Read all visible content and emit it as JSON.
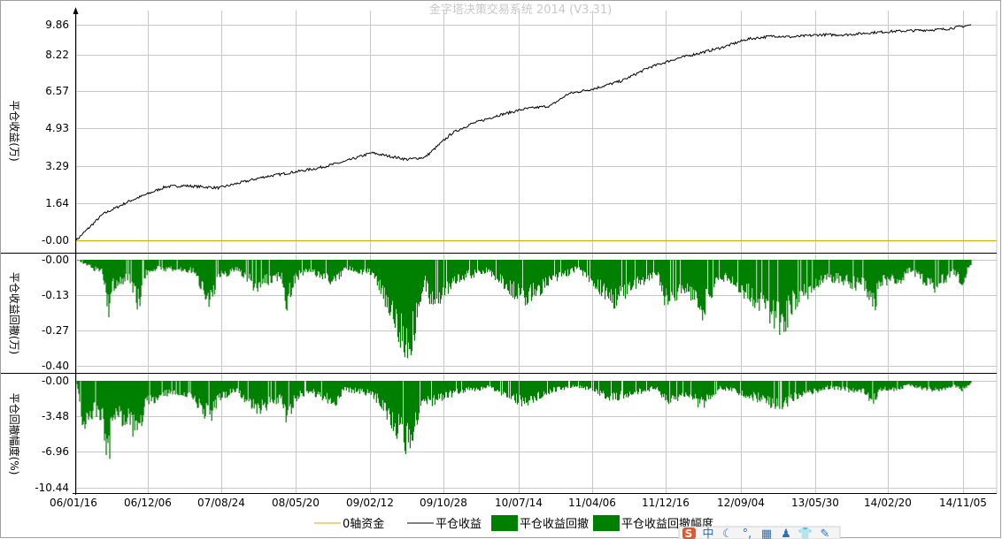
{
  "title": "金字塔决策交易系统 2014 (V3.31)",
  "colors": {
    "equity": "#000000",
    "zero_line": "#d4aa00",
    "drawdown": "#008000",
    "grid": "#c8c8c8",
    "toolbar_s": "#e8532a",
    "toolbar_blue": "#2e6fb8"
  },
  "x_tick_labels": [
    "06/01/16",
    "06/12/06",
    "07/08/24",
    "08/05/20",
    "09/02/12",
    "09/10/28",
    "10/07/14",
    "11/04/06",
    "11/12/16",
    "12/09/04",
    "13/05/30",
    "14/02/20",
    "14/11/05"
  ],
  "legend": [
    {
      "label": "0轴资金",
      "kind": "line",
      "color": "#d4aa00"
    },
    {
      "label": "平仓收益",
      "kind": "line",
      "color": "#000000"
    },
    {
      "label": "平仓收益回撤",
      "kind": "box",
      "color": "#008000"
    },
    {
      "label": "平仓收益回撤幅度",
      "kind": "box",
      "color": "#008000"
    }
  ],
  "toolbar_icons": [
    "sogou-s-icon",
    "chinese-input-icon",
    "moon-icon",
    "punctuation-icon",
    "keyboard-icon",
    "user-icon",
    "shirt-icon",
    "wrench-icon"
  ],
  "chart_data": [
    {
      "type": "line",
      "ylabel": "平仓收益(万)",
      "y_ticks": [
        "9.86",
        "8.22",
        "6.57",
        "4.93",
        "3.29",
        "1.64",
        "-0.00"
      ],
      "ylim": [
        -0.1,
        10.1
      ],
      "series": [
        {
          "name": "0轴资金",
          "values": [
            0.0,
            0.0
          ]
        },
        {
          "name": "平仓收益",
          "x": [
            0,
            0.01,
            0.03,
            0.06,
            0.1,
            0.12,
            0.16,
            0.21,
            0.27,
            0.3,
            0.33,
            0.37,
            0.39,
            0.42,
            0.44,
            0.47,
            0.5,
            0.53,
            0.55,
            0.58,
            0.61,
            0.64,
            0.67,
            0.69,
            0.72,
            0.75,
            0.78,
            0.8,
            0.83,
            0.86,
            0.89,
            0.91,
            0.94,
            0.97,
            1.0
          ],
          "values": [
            0.0,
            0.4,
            1.2,
            1.8,
            2.45,
            2.5,
            2.4,
            2.9,
            3.3,
            3.6,
            4.0,
            3.7,
            3.8,
            4.9,
            5.3,
            5.7,
            6.0,
            6.15,
            6.7,
            6.95,
            7.3,
            7.9,
            8.3,
            8.5,
            8.8,
            9.2,
            9.35,
            9.3,
            9.4,
            9.4,
            9.5,
            9.55,
            9.6,
            9.65,
            9.85
          ]
        }
      ]
    },
    {
      "type": "area",
      "ylabel": "平仓收益回撤(万)",
      "y_ticks": [
        "-0.00",
        "-0.13",
        "-0.27",
        "-0.40"
      ],
      "ylim": [
        -0.44,
        0.0
      ],
      "series": [
        {
          "name": "平仓收益回撤",
          "x": [
            0,
            0.03,
            0.036,
            0.04,
            0.06,
            0.07,
            0.075,
            0.08,
            0.09,
            0.13,
            0.15,
            0.16,
            0.18,
            0.2,
            0.23,
            0.235,
            0.245,
            0.26,
            0.29,
            0.3,
            0.33,
            0.34,
            0.365,
            0.37,
            0.375,
            0.39,
            0.395,
            0.43,
            0.46,
            0.5,
            0.53,
            0.56,
            0.6,
            0.65,
            0.66,
            0.68,
            0.7,
            0.72,
            0.74,
            0.79,
            0.8,
            0.84,
            0.88,
            0.89,
            0.9,
            0.92,
            0.93,
            0.96,
            0.98,
            0.99,
            1.0
          ],
          "values": [
            0,
            -0.06,
            -0.24,
            -0.12,
            -0.08,
            -0.2,
            -0.1,
            -0.05,
            -0.04,
            -0.05,
            -0.18,
            -0.08,
            -0.04,
            -0.12,
            -0.07,
            -0.2,
            -0.08,
            -0.05,
            -0.1,
            -0.04,
            -0.06,
            -0.12,
            -0.35,
            -0.4,
            -0.35,
            -0.1,
            -0.2,
            -0.08,
            -0.05,
            -0.18,
            -0.1,
            -0.04,
            -0.18,
            -0.06,
            -0.2,
            -0.12,
            -0.22,
            -0.07,
            -0.12,
            -0.29,
            -0.2,
            -0.08,
            -0.12,
            -0.22,
            -0.1,
            -0.1,
            -0.05,
            -0.12,
            -0.06,
            -0.1,
            -0.02
          ]
        }
      ]
    },
    {
      "type": "area",
      "ylabel": "平仓回撤幅度(%)",
      "y_ticks": [
        "-0.00",
        "-3.48",
        "-6.96",
        "-10.44"
      ],
      "ylim": [
        -10.9,
        0.0
      ],
      "series": [
        {
          "name": "平仓收益回撤幅度",
          "x": [
            0,
            0.01,
            0.02,
            0.03,
            0.036,
            0.04,
            0.06,
            0.07,
            0.075,
            0.08,
            0.1,
            0.13,
            0.15,
            0.16,
            0.18,
            0.2,
            0.23,
            0.235,
            0.245,
            0.26,
            0.29,
            0.3,
            0.33,
            0.34,
            0.365,
            0.37,
            0.375,
            0.39,
            0.395,
            0.43,
            0.46,
            0.5,
            0.53,
            0.56,
            0.6,
            0.65,
            0.66,
            0.68,
            0.7,
            0.72,
            0.74,
            0.79,
            0.8,
            0.84,
            0.88,
            0.89,
            0.9,
            0.92,
            0.93,
            0.96,
            0.98,
            0.99,
            1.0
          ],
          "values": [
            0,
            -6.0,
            -3.5,
            -4.0,
            -10.44,
            -4.0,
            -4.5,
            -7.5,
            -3.5,
            -2.5,
            -1.5,
            -1.8,
            -4.5,
            -2.0,
            -1.0,
            -3.5,
            -2.0,
            -4.5,
            -2.0,
            -1.2,
            -2.5,
            -1.0,
            -1.5,
            -2.5,
            -6.5,
            -7.3,
            -6.5,
            -2.0,
            -2.5,
            -1.2,
            -0.8,
            -2.5,
            -1.2,
            -0.6,
            -2.0,
            -0.8,
            -2.5,
            -1.5,
            -2.8,
            -0.8,
            -1.3,
            -3.0,
            -2.0,
            -0.8,
            -1.3,
            -2.3,
            -1.0,
            -1.0,
            -0.5,
            -1.2,
            -0.6,
            -1.0,
            -0.3
          ]
        }
      ]
    }
  ]
}
